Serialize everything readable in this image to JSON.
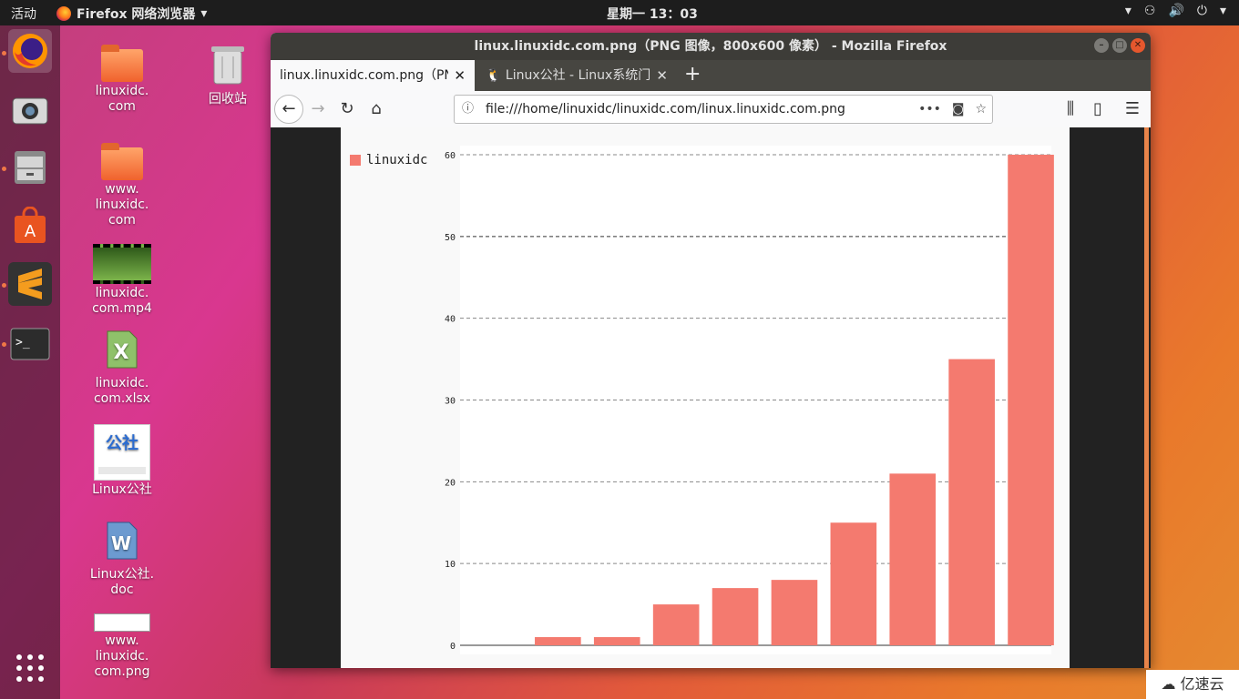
{
  "topbar": {
    "activities": "活动",
    "app_menu": "Firefox 网络浏览器",
    "clock": "星期一 13：03"
  },
  "desktop": {
    "icons": [
      {
        "label": "linuxidc.\ncom"
      },
      {
        "label": "回收站"
      },
      {
        "label": "www.\nlinuxidc.\ncom"
      },
      {
        "label": "linuxidc.\ncom.mp4"
      },
      {
        "label": "linuxidc.\ncom.xlsx"
      },
      {
        "label": "Linux公社"
      },
      {
        "label": "Linux公社.\ndoc"
      },
      {
        "label": "www.\nlinuxidc.\ncom.png"
      }
    ]
  },
  "window": {
    "title": "linux.linuxidc.com.png（PNG 图像，800x600 像素） - Mozilla Firefox",
    "tabs": [
      {
        "label": "linux.linuxidc.com.png（PNG"
      },
      {
        "label": "Linux公社 - Linux系统门户"
      }
    ],
    "url": "file:///home/linuxidc/linuxidc.com/linux.linuxidc.com.png"
  },
  "watermark": "亿速云",
  "colors": {
    "bar": "#f47a6f",
    "accent": "#e95420"
  },
  "chart_data": {
    "type": "bar",
    "legend": "linuxidc",
    "categories": [
      "",
      "",
      "",
      "",
      "",
      "",
      "",
      "",
      "",
      ""
    ],
    "values": [
      0,
      1,
      1,
      5,
      7,
      8,
      15,
      21,
      35,
      60
    ],
    "ylim": [
      0,
      60
    ],
    "yticks": [
      0,
      10,
      20,
      30,
      40,
      50,
      60
    ],
    "grid": true,
    "legend_position": "top-left"
  }
}
